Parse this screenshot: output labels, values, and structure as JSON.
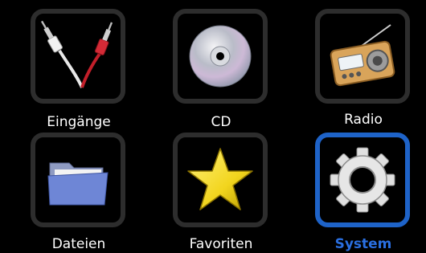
{
  "menu": {
    "items": [
      {
        "label": "Eingänge",
        "icon": "audio-cable-icon"
      },
      {
        "label": "CD",
        "icon": "cd-icon"
      },
      {
        "label": "Radio",
        "icon": "radio-icon"
      },
      {
        "label": "Dateien",
        "icon": "folder-icon"
      },
      {
        "label": "Favoriten",
        "icon": "star-icon"
      },
      {
        "label": "System",
        "icon": "gear-icon",
        "selected": true
      }
    ]
  },
  "colors": {
    "background": "#000000",
    "frame": "#2d2d2d",
    "selected_frame": "#1e63c8",
    "label": "#ffffff",
    "selected_label": "#2a6fe0"
  }
}
